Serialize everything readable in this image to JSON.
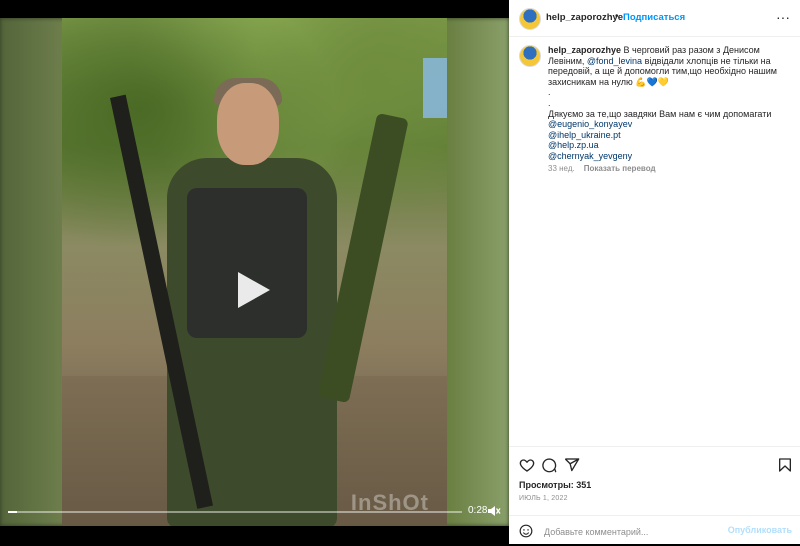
{
  "video": {
    "time": "0:28",
    "watermark": "InShOt",
    "progress_fraction": 0.02
  },
  "header": {
    "username": "help_zaporozhye",
    "separator": "•",
    "follow_label": "Подписаться",
    "more_label": "···"
  },
  "caption": {
    "username": "help_zaporozhye",
    "text_1": " В черговий раз разом з Денисом Левіним, ",
    "mention_1": "@fond_levina",
    "text_2": " відвідали хлопців не тільки на передовій, а ще й допомогли тим,що необхідно нашим захисникам на нулю 💪💙💛",
    "dot_1": ".",
    "dot_2": ".",
    "thanks": "Дякуємо за те,що завдяки Вам нам є чим допомагати",
    "mentions": [
      "@eugenio_konyayev",
      "@ihelp_ukraine.pt",
      "@help.zp.ua",
      "@chernyak_yevgeny"
    ],
    "age": "33 нед.",
    "translate": "Показать перевод"
  },
  "footer": {
    "views_label": "Просмотры:",
    "views_count": "351",
    "date": "ИЮЛЬ 1, 2022",
    "comment_placeholder": "Добавьте комментарий...",
    "post_label": "Опубликовать"
  },
  "colors": {
    "accent": "#0095f6",
    "link": "#00376b",
    "muted": "#8e8e8e"
  }
}
